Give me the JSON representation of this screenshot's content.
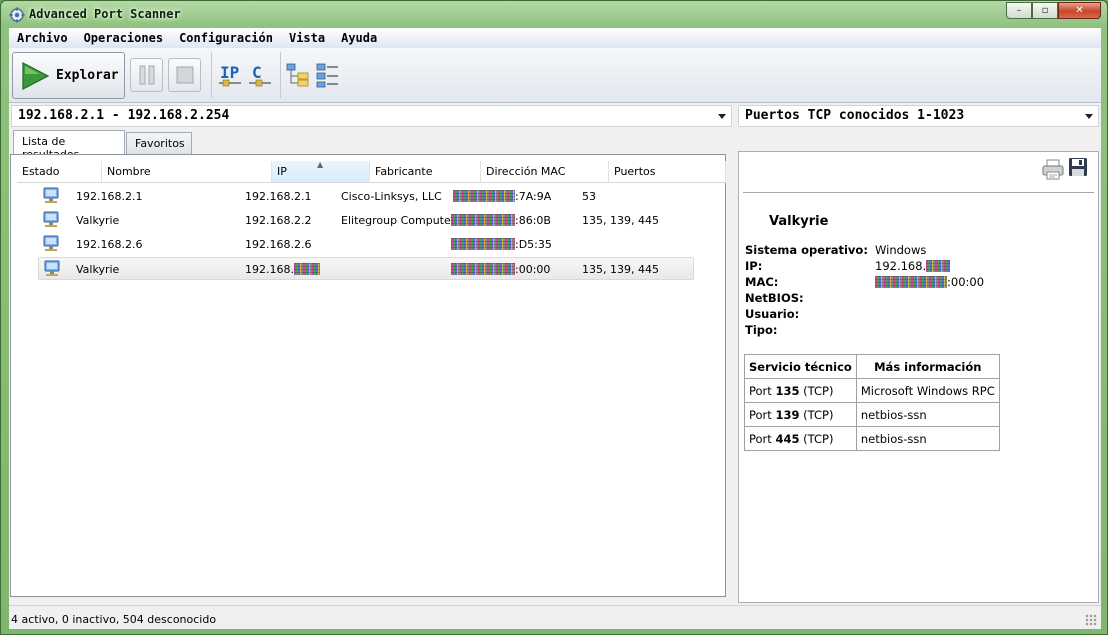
{
  "window": {
    "title": "Advanced Port Scanner",
    "controls": [
      "–",
      "▫",
      "✕"
    ]
  },
  "menu": [
    "Archivo",
    "Operaciones",
    "Configuración",
    "Vista",
    "Ayuda"
  ],
  "toolbar": {
    "explore_label": "Explorar",
    "ip_label": "IP",
    "c_label": "C"
  },
  "address": {
    "range": "192.168.2.1 - 192.168.2.254",
    "ports": "Puertos TCP conocidos 1-1023"
  },
  "tabs": [
    "Lista de resultados",
    "Favoritos"
  ],
  "results": {
    "columns": [
      "Estado",
      "Nombre",
      "IP",
      "Fabricante",
      "Dirección MAC",
      "Puertos"
    ],
    "sorted_column": "IP",
    "rows": [
      {
        "name": "192.168.2.1",
        "ip": "192.168.2.1",
        "ip_suffix": "",
        "vendor": "Cisco-Linksys, LLC",
        "mac_suffix": ":7A:9A",
        "ports": "53"
      },
      {
        "name": "Valkyrie",
        "ip": "192.168.2.2",
        "ip_suffix": "",
        "vendor": "Elitegroup Compute...",
        "mac_suffix": ":86:0B",
        "ports": "135, 139, 445"
      },
      {
        "name": "192.168.2.6",
        "ip": "192.168.2.6",
        "ip_suffix": "",
        "vendor": "",
        "mac_suffix": ":D5:35",
        "ports": ""
      },
      {
        "name": "Valkyrie",
        "ip": "192.168.",
        "ip_suffix": "redacted",
        "vendor": "",
        "mac_suffix": ":00:00",
        "ports": "135, 139, 445"
      }
    ],
    "selected_index": 3
  },
  "detail": {
    "name": "Valkyrie",
    "fields": [
      {
        "label": "Sistema operativo:",
        "value": "Windows"
      },
      {
        "label": "IP:",
        "value": "192.168."
      },
      {
        "label": "MAC:",
        "value": ":00:00"
      },
      {
        "label": "NetBIOS:",
        "value": ""
      },
      {
        "label": "Usuario:",
        "value": ""
      },
      {
        "label": "Tipo:",
        "value": ""
      }
    ],
    "services_header": [
      "Servicio técnico",
      "Más información"
    ],
    "services": [
      {
        "prefix": "Port ",
        "port": "135",
        "suffix": " (TCP)",
        "info": "Microsoft Windows RPC"
      },
      {
        "prefix": "Port ",
        "port": "139",
        "suffix": " (TCP)",
        "info": "netbios-ssn"
      },
      {
        "prefix": "Port ",
        "port": "445",
        "suffix": " (TCP)",
        "info": "netbios-ssn"
      }
    ],
    "icons": [
      "printer-icon",
      "save-icon"
    ]
  },
  "status": {
    "text": "4 activo, 0 inactivo, 504 desconocido"
  },
  "colors": {
    "frame_green": "#7fb56e",
    "play_green": "#3a9a3a",
    "ip_blue": "#1d63b8"
  }
}
